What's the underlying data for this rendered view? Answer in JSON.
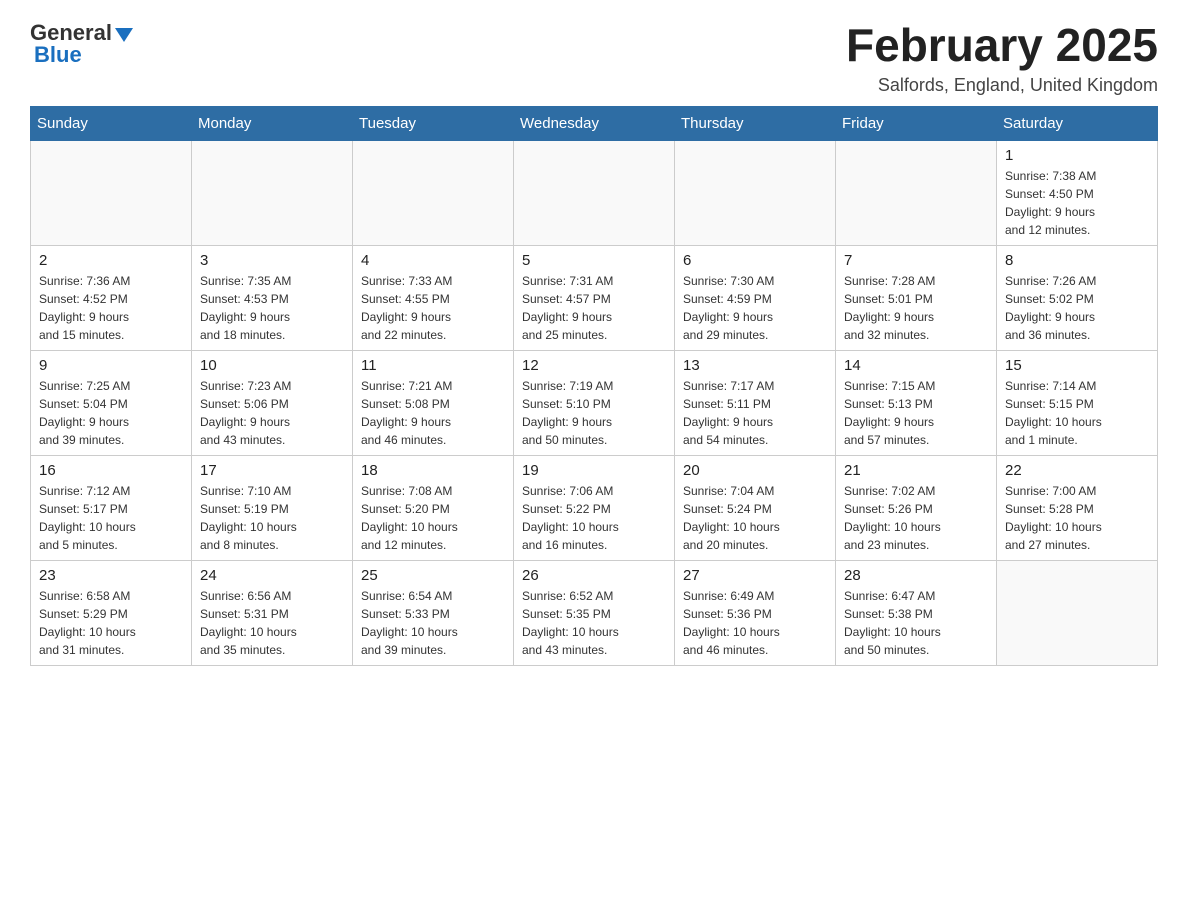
{
  "header": {
    "logo_general": "General",
    "logo_blue": "Blue",
    "month_year": "February 2025",
    "location": "Salfords, England, United Kingdom"
  },
  "weekdays": [
    "Sunday",
    "Monday",
    "Tuesday",
    "Wednesday",
    "Thursday",
    "Friday",
    "Saturday"
  ],
  "weeks": [
    [
      {
        "day": "",
        "info": ""
      },
      {
        "day": "",
        "info": ""
      },
      {
        "day": "",
        "info": ""
      },
      {
        "day": "",
        "info": ""
      },
      {
        "day": "",
        "info": ""
      },
      {
        "day": "",
        "info": ""
      },
      {
        "day": "1",
        "info": "Sunrise: 7:38 AM\nSunset: 4:50 PM\nDaylight: 9 hours\nand 12 minutes."
      }
    ],
    [
      {
        "day": "2",
        "info": "Sunrise: 7:36 AM\nSunset: 4:52 PM\nDaylight: 9 hours\nand 15 minutes."
      },
      {
        "day": "3",
        "info": "Sunrise: 7:35 AM\nSunset: 4:53 PM\nDaylight: 9 hours\nand 18 minutes."
      },
      {
        "day": "4",
        "info": "Sunrise: 7:33 AM\nSunset: 4:55 PM\nDaylight: 9 hours\nand 22 minutes."
      },
      {
        "day": "5",
        "info": "Sunrise: 7:31 AM\nSunset: 4:57 PM\nDaylight: 9 hours\nand 25 minutes."
      },
      {
        "day": "6",
        "info": "Sunrise: 7:30 AM\nSunset: 4:59 PM\nDaylight: 9 hours\nand 29 minutes."
      },
      {
        "day": "7",
        "info": "Sunrise: 7:28 AM\nSunset: 5:01 PM\nDaylight: 9 hours\nand 32 minutes."
      },
      {
        "day": "8",
        "info": "Sunrise: 7:26 AM\nSunset: 5:02 PM\nDaylight: 9 hours\nand 36 minutes."
      }
    ],
    [
      {
        "day": "9",
        "info": "Sunrise: 7:25 AM\nSunset: 5:04 PM\nDaylight: 9 hours\nand 39 minutes."
      },
      {
        "day": "10",
        "info": "Sunrise: 7:23 AM\nSunset: 5:06 PM\nDaylight: 9 hours\nand 43 minutes."
      },
      {
        "day": "11",
        "info": "Sunrise: 7:21 AM\nSunset: 5:08 PM\nDaylight: 9 hours\nand 46 minutes."
      },
      {
        "day": "12",
        "info": "Sunrise: 7:19 AM\nSunset: 5:10 PM\nDaylight: 9 hours\nand 50 minutes."
      },
      {
        "day": "13",
        "info": "Sunrise: 7:17 AM\nSunset: 5:11 PM\nDaylight: 9 hours\nand 54 minutes."
      },
      {
        "day": "14",
        "info": "Sunrise: 7:15 AM\nSunset: 5:13 PM\nDaylight: 9 hours\nand 57 minutes."
      },
      {
        "day": "15",
        "info": "Sunrise: 7:14 AM\nSunset: 5:15 PM\nDaylight: 10 hours\nand 1 minute."
      }
    ],
    [
      {
        "day": "16",
        "info": "Sunrise: 7:12 AM\nSunset: 5:17 PM\nDaylight: 10 hours\nand 5 minutes."
      },
      {
        "day": "17",
        "info": "Sunrise: 7:10 AM\nSunset: 5:19 PM\nDaylight: 10 hours\nand 8 minutes."
      },
      {
        "day": "18",
        "info": "Sunrise: 7:08 AM\nSunset: 5:20 PM\nDaylight: 10 hours\nand 12 minutes."
      },
      {
        "day": "19",
        "info": "Sunrise: 7:06 AM\nSunset: 5:22 PM\nDaylight: 10 hours\nand 16 minutes."
      },
      {
        "day": "20",
        "info": "Sunrise: 7:04 AM\nSunset: 5:24 PM\nDaylight: 10 hours\nand 20 minutes."
      },
      {
        "day": "21",
        "info": "Sunrise: 7:02 AM\nSunset: 5:26 PM\nDaylight: 10 hours\nand 23 minutes."
      },
      {
        "day": "22",
        "info": "Sunrise: 7:00 AM\nSunset: 5:28 PM\nDaylight: 10 hours\nand 27 minutes."
      }
    ],
    [
      {
        "day": "23",
        "info": "Sunrise: 6:58 AM\nSunset: 5:29 PM\nDaylight: 10 hours\nand 31 minutes."
      },
      {
        "day": "24",
        "info": "Sunrise: 6:56 AM\nSunset: 5:31 PM\nDaylight: 10 hours\nand 35 minutes."
      },
      {
        "day": "25",
        "info": "Sunrise: 6:54 AM\nSunset: 5:33 PM\nDaylight: 10 hours\nand 39 minutes."
      },
      {
        "day": "26",
        "info": "Sunrise: 6:52 AM\nSunset: 5:35 PM\nDaylight: 10 hours\nand 43 minutes."
      },
      {
        "day": "27",
        "info": "Sunrise: 6:49 AM\nSunset: 5:36 PM\nDaylight: 10 hours\nand 46 minutes."
      },
      {
        "day": "28",
        "info": "Sunrise: 6:47 AM\nSunset: 5:38 PM\nDaylight: 10 hours\nand 50 minutes."
      },
      {
        "day": "",
        "info": ""
      }
    ]
  ]
}
